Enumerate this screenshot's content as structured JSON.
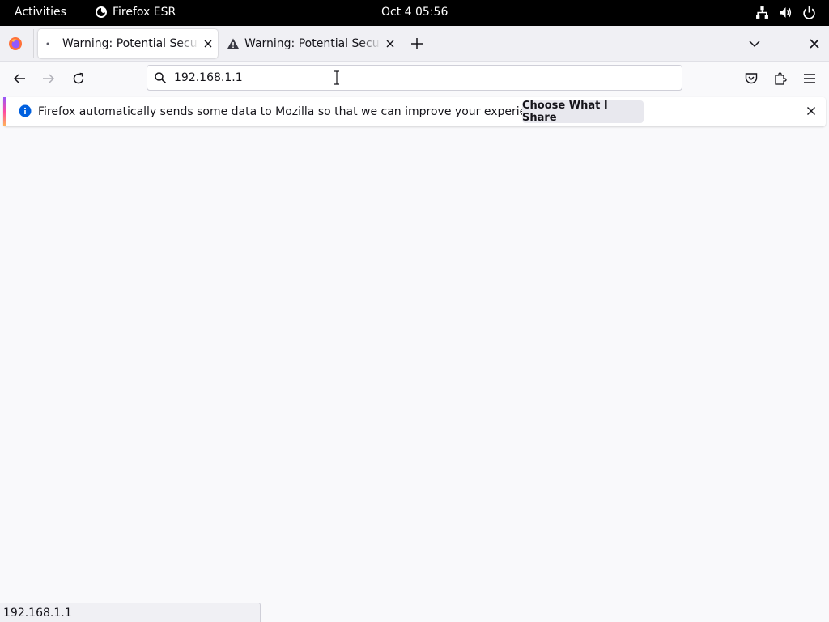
{
  "topbar": {
    "activities": "Activities",
    "app_name": "Firefox ESR",
    "clock": "Oct 4  05:56",
    "tray_icons": [
      "network-icon",
      "volume-icon",
      "power-icon"
    ]
  },
  "tabs": [
    {
      "title": "Warning: Potential Security Risk Ahead",
      "icon": "loading-dot-icon",
      "active": true
    },
    {
      "title": "Warning: Potential Security Risk Ahead",
      "icon": "warning-icon",
      "active": false
    }
  ],
  "urlbar": {
    "value": "192.168.1.1"
  },
  "notification": {
    "message": "Firefox automatically sends some data to Mozilla so that we can improve your experience.",
    "button_label": "Choose What I Share"
  },
  "statusbar": {
    "text": "192.168.1.1"
  },
  "colors": {
    "topbar_bg": "#000000",
    "tabstrip_bg": "#f0f0f4",
    "content_bg": "#f9f9fb",
    "info_blue": "#0060df"
  }
}
